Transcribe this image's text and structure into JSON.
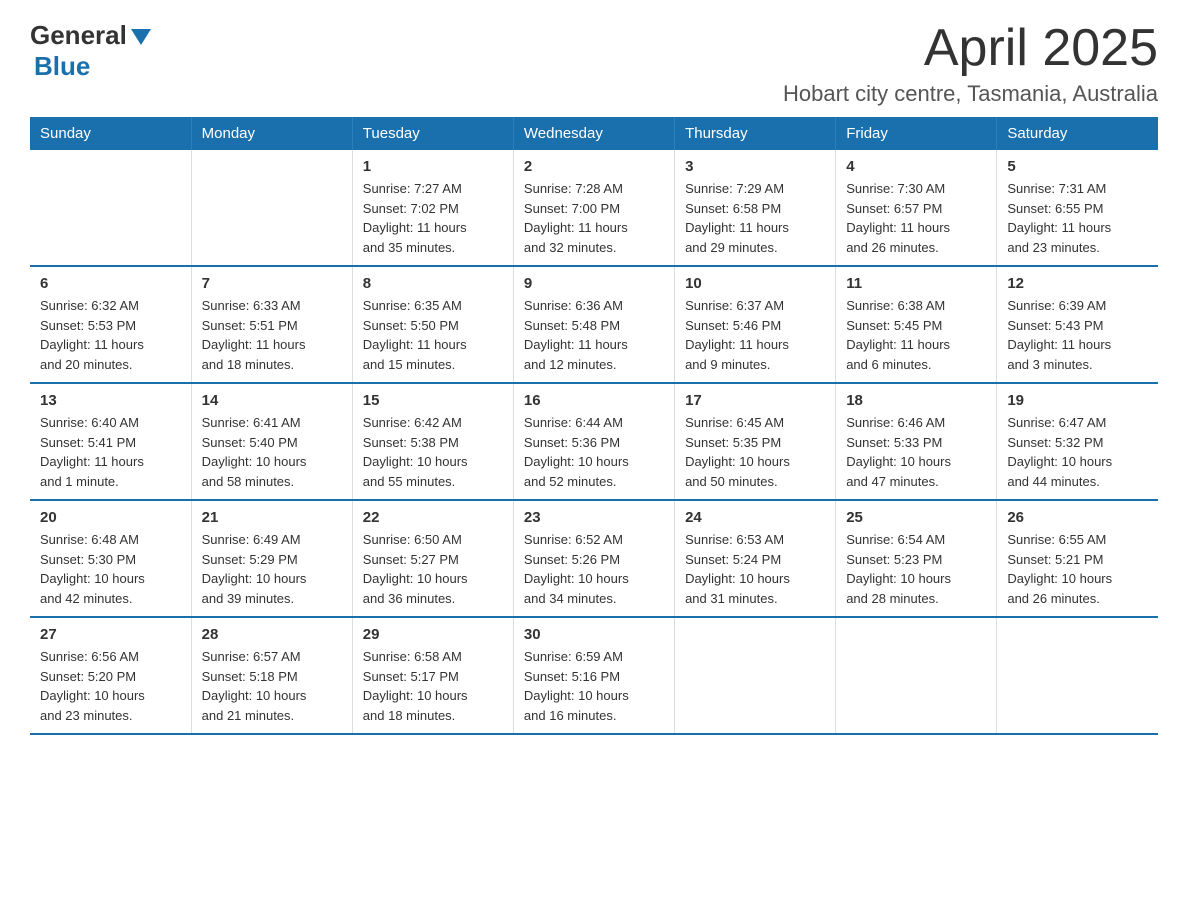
{
  "header": {
    "logo_general": "General",
    "logo_blue": "Blue",
    "title": "April 2025",
    "subtitle": "Hobart city centre, Tasmania, Australia"
  },
  "weekdays": [
    "Sunday",
    "Monday",
    "Tuesday",
    "Wednesday",
    "Thursday",
    "Friday",
    "Saturday"
  ],
  "weeks": [
    [
      {
        "day": "",
        "info": ""
      },
      {
        "day": "",
        "info": ""
      },
      {
        "day": "1",
        "info": "Sunrise: 7:27 AM\nSunset: 7:02 PM\nDaylight: 11 hours\nand 35 minutes."
      },
      {
        "day": "2",
        "info": "Sunrise: 7:28 AM\nSunset: 7:00 PM\nDaylight: 11 hours\nand 32 minutes."
      },
      {
        "day": "3",
        "info": "Sunrise: 7:29 AM\nSunset: 6:58 PM\nDaylight: 11 hours\nand 29 minutes."
      },
      {
        "day": "4",
        "info": "Sunrise: 7:30 AM\nSunset: 6:57 PM\nDaylight: 11 hours\nand 26 minutes."
      },
      {
        "day": "5",
        "info": "Sunrise: 7:31 AM\nSunset: 6:55 PM\nDaylight: 11 hours\nand 23 minutes."
      }
    ],
    [
      {
        "day": "6",
        "info": "Sunrise: 6:32 AM\nSunset: 5:53 PM\nDaylight: 11 hours\nand 20 minutes."
      },
      {
        "day": "7",
        "info": "Sunrise: 6:33 AM\nSunset: 5:51 PM\nDaylight: 11 hours\nand 18 minutes."
      },
      {
        "day": "8",
        "info": "Sunrise: 6:35 AM\nSunset: 5:50 PM\nDaylight: 11 hours\nand 15 minutes."
      },
      {
        "day": "9",
        "info": "Sunrise: 6:36 AM\nSunset: 5:48 PM\nDaylight: 11 hours\nand 12 minutes."
      },
      {
        "day": "10",
        "info": "Sunrise: 6:37 AM\nSunset: 5:46 PM\nDaylight: 11 hours\nand 9 minutes."
      },
      {
        "day": "11",
        "info": "Sunrise: 6:38 AM\nSunset: 5:45 PM\nDaylight: 11 hours\nand 6 minutes."
      },
      {
        "day": "12",
        "info": "Sunrise: 6:39 AM\nSunset: 5:43 PM\nDaylight: 11 hours\nand 3 minutes."
      }
    ],
    [
      {
        "day": "13",
        "info": "Sunrise: 6:40 AM\nSunset: 5:41 PM\nDaylight: 11 hours\nand 1 minute."
      },
      {
        "day": "14",
        "info": "Sunrise: 6:41 AM\nSunset: 5:40 PM\nDaylight: 10 hours\nand 58 minutes."
      },
      {
        "day": "15",
        "info": "Sunrise: 6:42 AM\nSunset: 5:38 PM\nDaylight: 10 hours\nand 55 minutes."
      },
      {
        "day": "16",
        "info": "Sunrise: 6:44 AM\nSunset: 5:36 PM\nDaylight: 10 hours\nand 52 minutes."
      },
      {
        "day": "17",
        "info": "Sunrise: 6:45 AM\nSunset: 5:35 PM\nDaylight: 10 hours\nand 50 minutes."
      },
      {
        "day": "18",
        "info": "Sunrise: 6:46 AM\nSunset: 5:33 PM\nDaylight: 10 hours\nand 47 minutes."
      },
      {
        "day": "19",
        "info": "Sunrise: 6:47 AM\nSunset: 5:32 PM\nDaylight: 10 hours\nand 44 minutes."
      }
    ],
    [
      {
        "day": "20",
        "info": "Sunrise: 6:48 AM\nSunset: 5:30 PM\nDaylight: 10 hours\nand 42 minutes."
      },
      {
        "day": "21",
        "info": "Sunrise: 6:49 AM\nSunset: 5:29 PM\nDaylight: 10 hours\nand 39 minutes."
      },
      {
        "day": "22",
        "info": "Sunrise: 6:50 AM\nSunset: 5:27 PM\nDaylight: 10 hours\nand 36 minutes."
      },
      {
        "day": "23",
        "info": "Sunrise: 6:52 AM\nSunset: 5:26 PM\nDaylight: 10 hours\nand 34 minutes."
      },
      {
        "day": "24",
        "info": "Sunrise: 6:53 AM\nSunset: 5:24 PM\nDaylight: 10 hours\nand 31 minutes."
      },
      {
        "day": "25",
        "info": "Sunrise: 6:54 AM\nSunset: 5:23 PM\nDaylight: 10 hours\nand 28 minutes."
      },
      {
        "day": "26",
        "info": "Sunrise: 6:55 AM\nSunset: 5:21 PM\nDaylight: 10 hours\nand 26 minutes."
      }
    ],
    [
      {
        "day": "27",
        "info": "Sunrise: 6:56 AM\nSunset: 5:20 PM\nDaylight: 10 hours\nand 23 minutes."
      },
      {
        "day": "28",
        "info": "Sunrise: 6:57 AM\nSunset: 5:18 PM\nDaylight: 10 hours\nand 21 minutes."
      },
      {
        "day": "29",
        "info": "Sunrise: 6:58 AM\nSunset: 5:17 PM\nDaylight: 10 hours\nand 18 minutes."
      },
      {
        "day": "30",
        "info": "Sunrise: 6:59 AM\nSunset: 5:16 PM\nDaylight: 10 hours\nand 16 minutes."
      },
      {
        "day": "",
        "info": ""
      },
      {
        "day": "",
        "info": ""
      },
      {
        "day": "",
        "info": ""
      }
    ]
  ]
}
